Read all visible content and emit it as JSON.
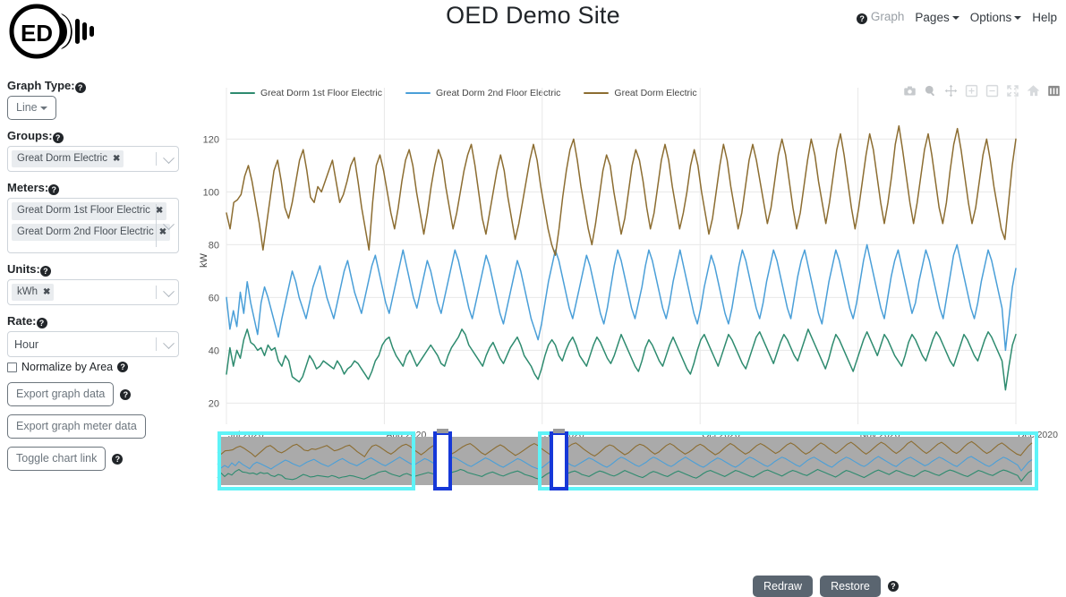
{
  "header": {
    "title": "OED Demo Site",
    "logo_text": "ED",
    "logo_name": "oed-lightbulb-logo",
    "nav": [
      {
        "label": "Graph",
        "icon": "help-circle-icon",
        "has_caret": false,
        "muted": true
      },
      {
        "label": "Pages",
        "has_caret": true,
        "muted": false
      },
      {
        "label": "Options",
        "has_caret": true,
        "muted": false
      },
      {
        "label": "Help",
        "has_caret": false,
        "muted": false
      }
    ]
  },
  "sidebar": {
    "graph_type": {
      "label": "Graph Type:",
      "value": "Line"
    },
    "groups": {
      "label": "Groups:",
      "chips": [
        "Great Dorm Electric"
      ]
    },
    "meters": {
      "label": "Meters:",
      "chips": [
        "Great Dorm 1st Floor Electric",
        "Great Dorm 2nd Floor Electric"
      ]
    },
    "units": {
      "label": "Units:",
      "chips": [
        "kWh"
      ]
    },
    "rate": {
      "label": "Rate:",
      "value": "Hour"
    },
    "normalize": {
      "label": "Normalize by Area"
    },
    "buttons": [
      {
        "label": "Export graph data",
        "has_help": true
      },
      {
        "label": "Export graph meter data",
        "has_help": false
      },
      {
        "label": "Toggle chart link",
        "has_help": true
      }
    ]
  },
  "chart_panel": {
    "modebar": [
      "camera-icon",
      "zoom-magnifier-icon",
      "pan-move-icon",
      "zoom-in-icon",
      "zoom-out-icon",
      "autoscale-icon",
      "reset-home-icon",
      "toggle-spike-grid-icon"
    ],
    "actions": {
      "redraw": "Redraw",
      "restore": "Restore",
      "help_icon": "help-circle-icon"
    }
  },
  "chart_data": {
    "type": "line",
    "title": "",
    "xlabel": "",
    "ylabel": "kW",
    "ylim": [
      12,
      132
    ],
    "yticks": [
      20,
      40,
      60,
      80,
      100,
      120
    ],
    "xticks": [
      "Jul 2020",
      "Aug 2020",
      "Sep 2020",
      "Oct 2020",
      "Nov 2020",
      "Dec 2020"
    ],
    "xlim": [
      "Jul 2020",
      "Dec 2020"
    ],
    "grid": true,
    "legend_position": "top-left",
    "rangeslider": true,
    "series": [
      {
        "name": "Great Dorm 1st Floor Electric",
        "color": "#2e8b6f",
        "mean": 38,
        "values": [
          31,
          41,
          34,
          40,
          37,
          44,
          48,
          43,
          42,
          40,
          41,
          38,
          42,
          40,
          41,
          36,
          34,
          38,
          36,
          30,
          29,
          28,
          30,
          34,
          38,
          36,
          33,
          34,
          36,
          35,
          34,
          33,
          36,
          34,
          31,
          33,
          34,
          36,
          35,
          33,
          31,
          29,
          32,
          36,
          38,
          42,
          44,
          45,
          41,
          38,
          36,
          34,
          38,
          40,
          37,
          34,
          36,
          38,
          40,
          42,
          40,
          38,
          35,
          34,
          38,
          41,
          43,
          45,
          48,
          46,
          42,
          40,
          38,
          36,
          34,
          38,
          41,
          43,
          40,
          37,
          35,
          38,
          41,
          43,
          45,
          42,
          38,
          36,
          34,
          31,
          29,
          33,
          38,
          42,
          44,
          42,
          38,
          36,
          40,
          43,
          45,
          42,
          38,
          36,
          34,
          38,
          42,
          45,
          43,
          40,
          37,
          35,
          38,
          42,
          46,
          43,
          40,
          37,
          34,
          32,
          36,
          41,
          44,
          42,
          39,
          36,
          34,
          38,
          42,
          45,
          42,
          39,
          36,
          33,
          31,
          35,
          40,
          44,
          46,
          43,
          40,
          37,
          34,
          38,
          42,
          46,
          44,
          41,
          38,
          35,
          33,
          37,
          41,
          45,
          47,
          44,
          41,
          38,
          35,
          39,
          43,
          46,
          44,
          41,
          38,
          36,
          40,
          44,
          48,
          45,
          42,
          39,
          36,
          33,
          37,
          42,
          46,
          44,
          41,
          38,
          35,
          32,
          36,
          40,
          44,
          47,
          44,
          41,
          38,
          42,
          46,
          44,
          41,
          38,
          36,
          34,
          38,
          43,
          46,
          44,
          41,
          38,
          36,
          40,
          44,
          47,
          45,
          42,
          39,
          36,
          34,
          38,
          42,
          46,
          44,
          41,
          38,
          36,
          40,
          44,
          47,
          45,
          42,
          39,
          36,
          25,
          34,
          42,
          46
        ]
      },
      {
        "name": "Great Dorm 2nd Floor Electric",
        "color": "#4a9fd8",
        "mean": 56,
        "values": [
          60,
          48,
          55,
          49,
          62,
          54,
          66,
          58,
          52,
          46,
          58,
          64,
          60,
          55,
          50,
          45,
          52,
          58,
          64,
          70,
          66,
          60,
          56,
          52,
          58,
          64,
          68,
          72,
          66,
          60,
          56,
          52,
          58,
          64,
          70,
          74,
          68,
          62,
          58,
          54,
          60,
          66,
          72,
          76,
          70,
          64,
          58,
          54,
          60,
          66,
          72,
          78,
          72,
          66,
          60,
          56,
          62,
          68,
          74,
          70,
          64,
          58,
          54,
          60,
          66,
          72,
          78,
          74,
          68,
          62,
          56,
          52,
          58,
          64,
          70,
          76,
          72,
          66,
          60,
          54,
          50,
          56,
          62,
          68,
          74,
          70,
          64,
          58,
          52,
          48,
          44,
          50,
          58,
          66,
          72,
          78,
          74,
          68,
          62,
          56,
          52,
          58,
          64,
          70,
          76,
          72,
          66,
          60,
          54,
          50,
          56,
          64,
          72,
          78,
          74,
          68,
          62,
          56,
          52,
          58,
          64,
          72,
          78,
          74,
          68,
          62,
          56,
          52,
          58,
          66,
          72,
          78,
          72,
          66,
          60,
          54,
          50,
          56,
          64,
          70,
          76,
          72,
          66,
          60,
          54,
          50,
          56,
          64,
          72,
          78,
          74,
          68,
          62,
          56,
          52,
          58,
          66,
          72,
          78,
          74,
          68,
          62,
          56,
          52,
          60,
          68,
          74,
          78,
          72,
          66,
          60,
          54,
          50,
          58,
          66,
          72,
          78,
          74,
          68,
          62,
          56,
          52,
          58,
          66,
          74,
          80,
          74,
          68,
          62,
          56,
          52,
          60,
          68,
          74,
          78,
          72,
          66,
          60,
          54,
          58,
          66,
          72,
          78,
          74,
          68,
          62,
          56,
          52,
          60,
          68,
          76,
          80,
          74,
          68,
          62,
          56,
          52,
          58,
          66,
          72,
          78,
          74,
          68,
          62,
          56,
          40,
          52,
          64,
          71
        ]
      },
      {
        "name": "Great Dorm Electric",
        "color": "#8c6d31",
        "mean": 98,
        "values": [
          92,
          86,
          96,
          97,
          99,
          106,
          110,
          104,
          96,
          88,
          78,
          88,
          98,
          108,
          112,
          104,
          94,
          90,
          96,
          104,
          112,
          116,
          108,
          98,
          96,
          102,
          100,
          104,
          108,
          112,
          104,
          96,
          99,
          104,
          110,
          113,
          104,
          94,
          86,
          78,
          96,
          110,
          114,
          108,
          100,
          92,
          86,
          94,
          104,
          112,
          116,
          110,
          100,
          92,
          84,
          92,
          102,
          110,
          116,
          112,
          102,
          94,
          86,
          92,
          100,
          108,
          114,
          118,
          110,
          100,
          90,
          84,
          92,
          100,
          108,
          114,
          108,
          98,
          90,
          82,
          88,
          96,
          104,
          112,
          118,
          112,
          102,
          94,
          86,
          80,
          76,
          86,
          98,
          108,
          116,
          120,
          112,
          102,
          94,
          86,
          80,
          88,
          98,
          108,
          114,
          110,
          100,
          92,
          84,
          90,
          100,
          110,
          116,
          112,
          104,
          94,
          86,
          92,
          102,
          112,
          118,
          112,
          102,
          94,
          86,
          92,
          100,
          110,
          116,
          110,
          100,
          92,
          84,
          90,
          100,
          110,
          118,
          112,
          102,
          94,
          86,
          92,
          102,
          112,
          118,
          112,
          104,
          96,
          88,
          94,
          104,
          114,
          120,
          114,
          104,
          94,
          86,
          92,
          102,
          112,
          120,
          114,
          104,
          96,
          88,
          96,
          106,
          116,
          122,
          114,
          104,
          94,
          86,
          94,
          104,
          114,
          122,
          116,
          106,
          96,
          88,
          96,
          106,
          118,
          125,
          116,
          106,
          96,
          88,
          96,
          106,
          116,
          122,
          114,
          104,
          94,
          88,
          96,
          108,
          118,
          124,
          116,
          106,
          96,
          88,
          94,
          104,
          114,
          120,
          112,
          102,
          94,
          86,
          82,
          96,
          110,
          120
        ]
      }
    ]
  }
}
